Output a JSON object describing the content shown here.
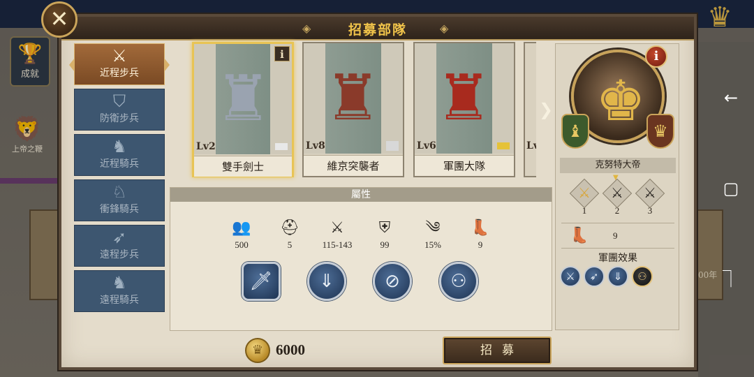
{
  "background": {
    "achievement_label": "成就",
    "lion_label": "上帝之鞭",
    "year_fragment": "00年"
  },
  "dialog": {
    "title": "招募部隊",
    "close_icon": "close-icon"
  },
  "categories": [
    {
      "label": "近程步兵",
      "icon": "crossed-swords-icon",
      "active": true
    },
    {
      "label": "防衛步兵",
      "icon": "shield-icon",
      "active": false
    },
    {
      "label": "近程騎兵",
      "icon": "horse-head-icon",
      "active": false
    },
    {
      "label": "衝鋒騎兵",
      "icon": "charging-horse-icon",
      "active": false
    },
    {
      "label": "遠程步兵",
      "icon": "bow-icon",
      "active": false
    },
    {
      "label": "遠程騎兵",
      "icon": "horse-archer-icon",
      "active": false
    }
  ],
  "units": [
    {
      "name": "雙手劍士",
      "level": "Lv2",
      "selected": true,
      "rank_color": "#e8e8e8",
      "info": "i"
    },
    {
      "name": "維京突襲者",
      "level": "Lv8",
      "selected": false,
      "rank_color": "#d8d8d8"
    },
    {
      "name": "軍團大隊",
      "level": "Lv6",
      "selected": false,
      "rank_color": "#e5c238"
    },
    {
      "name": "",
      "level": "Lv",
      "selected": false
    }
  ],
  "attributes": {
    "header": "屬性",
    "stats": [
      {
        "icon": "troops-icon",
        "value": "500"
      },
      {
        "icon": "helmet-icon",
        "value": "5"
      },
      {
        "icon": "attack-swords-icon",
        "value": "115-143"
      },
      {
        "icon": "defense-shield-icon",
        "value": "99"
      },
      {
        "icon": "wind-icon",
        "value": "15%"
      },
      {
        "icon": "boot-icon",
        "value": "9"
      }
    ],
    "skills": [
      "sword-skill-icon",
      "arrow-down-skill-icon",
      "shield-break-skill-icon",
      "formation-skill-icon"
    ]
  },
  "commander": {
    "name": "克努特大帝",
    "info": "i",
    "slots": [
      {
        "number": "1",
        "lit": true
      },
      {
        "number": "2",
        "lit": false
      },
      {
        "number": "3",
        "lit": false
      }
    ],
    "speed": "9",
    "effects_label": "軍團效果",
    "effects": [
      "effect-1-icon",
      "effect-2-icon",
      "effect-3-icon",
      "effect-4-icon"
    ]
  },
  "cost": {
    "amount": "6000",
    "currency_icon": "gold-coin-icon"
  },
  "recruit_label": "招募",
  "colors": {
    "accent_gold": "#f0c34a",
    "tab_active": "#a26a3a",
    "tab_inactive": "#3d5670",
    "panel_bg": "#e4dccb"
  }
}
